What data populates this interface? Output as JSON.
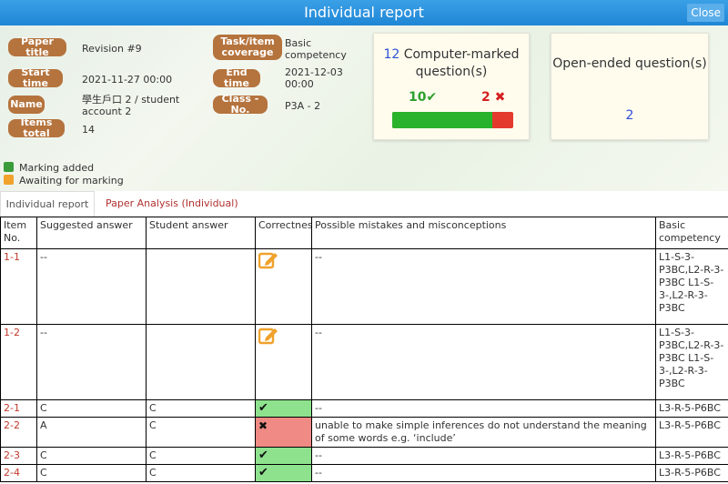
{
  "window": {
    "title": "Individual report",
    "close_label": "Close"
  },
  "info": {
    "paper_title_label": "Paper title",
    "paper_title": "Revision #9",
    "start_time_label": "Start time",
    "start_time": "2021-11-27 00:00",
    "name_label": "Name",
    "name_value": "學生戶口 2 / student account 2",
    "items_total_label": "Items total",
    "items_total": "14",
    "coverage_label": "Task/item coverage",
    "coverage_value": "Basic competency",
    "end_time_label": "End time",
    "end_time": "2021-12-03 00:00",
    "class_label": "Class - No.",
    "class_value": "P3A - 2"
  },
  "computer_marked": {
    "count": "12",
    "title": "Computer-marked question(s)",
    "correct": "10",
    "wrong": "2",
    "correct_fraction": 0.83,
    "colors": {
      "correct": "#29b22b",
      "wrong": "#e43a2e"
    }
  },
  "open_ended": {
    "title": "Open-ended question(s)",
    "count": "2"
  },
  "legend": {
    "marking_added": "Marking added",
    "awaiting": "Awaiting for marking"
  },
  "tabs": {
    "active": "Individual report",
    "other": "Paper Analysis (Individual)"
  },
  "table": {
    "headers": [
      "Item No.",
      "Suggested answer",
      "Student answer",
      "Correctness",
      "Possible mistakes and misconceptions",
      "Basic competency"
    ],
    "rows": [
      {
        "item": "1-1",
        "suggested": "--",
        "student": "",
        "status": "pending",
        "mistakes": "--",
        "competency": "L1-S-3-P3BC,L2-R-3-P3BC L1-S-3-,L2-R-3-P3BC"
      },
      {
        "item": "1-2",
        "suggested": "--",
        "student": "",
        "status": "pending",
        "mistakes": "--",
        "competency": "L1-S-3-P3BC,L2-R-3-P3BC L1-S-3-,L2-R-3-P3BC"
      },
      {
        "item": "2-1",
        "suggested": "C",
        "student": "C",
        "status": "correct",
        "mistakes": "--",
        "competency": "L3-R-5-P6BC"
      },
      {
        "item": "2-2",
        "suggested": "A",
        "student": "C",
        "status": "wrong",
        "mistakes": "unable to make simple inferences do not understand the meaning of some words e.g. ‘include’",
        "competency": "L3-R-5-P6BC"
      },
      {
        "item": "2-3",
        "suggested": "C",
        "student": "C",
        "status": "correct",
        "mistakes": "--",
        "competency": "L3-R-5-P6BC"
      },
      {
        "item": "2-4",
        "suggested": "C",
        "student": "C",
        "status": "correct",
        "mistakes": "--",
        "competency": "L3-R-5-P6BC"
      }
    ]
  }
}
